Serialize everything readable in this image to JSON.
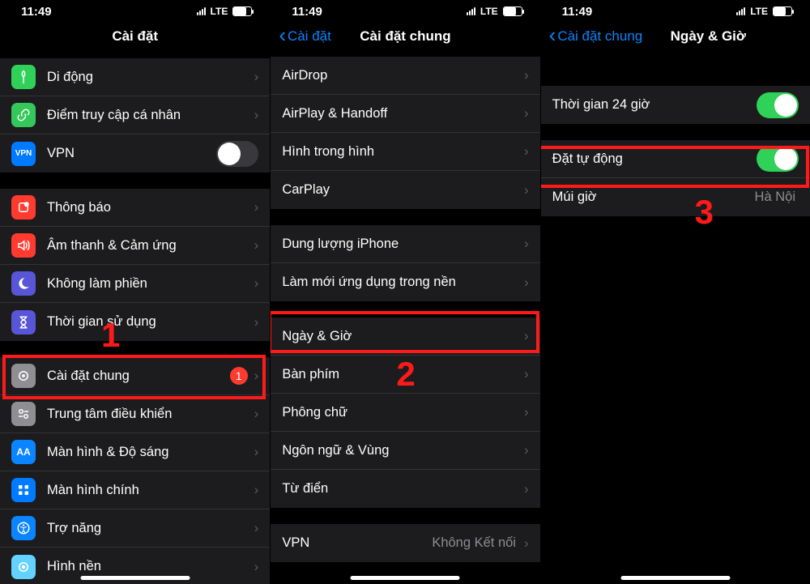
{
  "status": {
    "time": "11:49",
    "net": "LTE"
  },
  "panel1": {
    "title": "Cài đặt",
    "group1": [
      {
        "label": "Di động",
        "icon": "antenna",
        "bg": "bg-green"
      },
      {
        "label": "Điểm truy cập cá nhân",
        "icon": "link",
        "bg": "bg-green2"
      },
      {
        "label": "VPN",
        "icon": "vpn",
        "bg": "bg-blue",
        "toggle": false
      }
    ],
    "group2": [
      {
        "label": "Thông báo",
        "icon": "bell",
        "bg": "bg-red"
      },
      {
        "label": "Âm thanh & Cảm ứng",
        "icon": "speaker",
        "bg": "bg-red"
      },
      {
        "label": "Không làm phiền",
        "icon": "moon",
        "bg": "bg-purple"
      },
      {
        "label": "Thời gian sử dụng",
        "icon": "hourglass",
        "bg": "bg-purple"
      }
    ],
    "group3": [
      {
        "label": "Cài đặt chung",
        "icon": "gear",
        "bg": "bg-grey",
        "badge": "1"
      },
      {
        "label": "Trung tâm điều khiển",
        "icon": "switches",
        "bg": "bg-grey"
      },
      {
        "label": "Màn hình & Độ sáng",
        "icon": "aa",
        "bg": "bg-blue2"
      },
      {
        "label": "Màn hình chính",
        "icon": "grid",
        "bg": "bg-blue"
      },
      {
        "label": "Trợ năng",
        "icon": "access",
        "bg": "bg-blue2"
      },
      {
        "label": "Hình nền",
        "icon": "wallpaper",
        "bg": "bg-teal"
      }
    ],
    "annot": "1"
  },
  "panel2": {
    "back": "Cài đặt",
    "title": "Cài đặt chung",
    "group1": [
      {
        "label": "AirDrop"
      },
      {
        "label": "AirPlay & Handoff"
      },
      {
        "label": "Hình trong hình"
      },
      {
        "label": "CarPlay"
      }
    ],
    "group2": [
      {
        "label": "Dung lượng iPhone"
      },
      {
        "label": "Làm mới ứng dụng trong nền"
      }
    ],
    "group3": [
      {
        "label": "Ngày & Giờ"
      },
      {
        "label": "Bàn phím"
      },
      {
        "label": "Phông chữ"
      },
      {
        "label": "Ngôn ngữ & Vùng"
      },
      {
        "label": "Từ điển"
      }
    ],
    "group4": [
      {
        "label": "VPN",
        "value": "Không Kết nối"
      }
    ],
    "annot": "2"
  },
  "panel3": {
    "back": "Cài đặt chung",
    "title": "Ngày & Giờ",
    "group1": [
      {
        "label": "Thời gian 24 giờ",
        "toggle": true
      }
    ],
    "group2": [
      {
        "label": "Đặt tự động",
        "toggle": true
      },
      {
        "label": "Múi giờ",
        "value": "Hà Nội"
      }
    ],
    "annot": "3"
  }
}
